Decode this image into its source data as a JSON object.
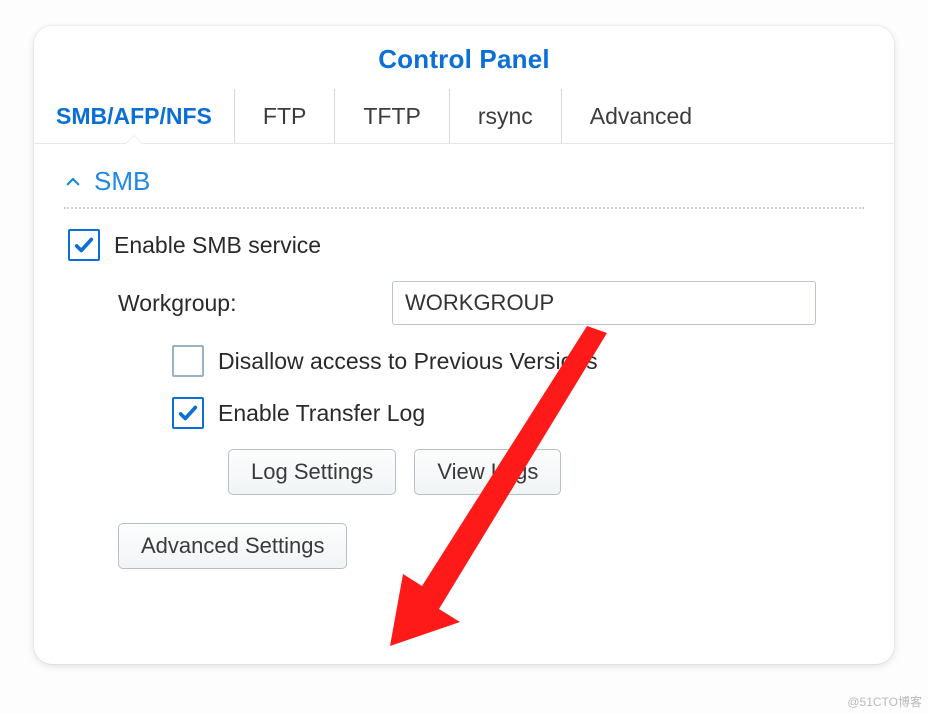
{
  "title": "Control Panel",
  "tabs": [
    {
      "label": "SMB/AFP/NFS",
      "active": true
    },
    {
      "label": "FTP"
    },
    {
      "label": "TFTP"
    },
    {
      "label": "rsync"
    },
    {
      "label": "Advanced"
    }
  ],
  "section": {
    "header_label": "SMB",
    "collapsed": false
  },
  "smb": {
    "enable_service": {
      "label": "Enable SMB service",
      "checked": true
    },
    "workgroup": {
      "label": "Workgroup:",
      "value": "WORKGROUP"
    },
    "disallow_prev": {
      "label": "Disallow access to Previous Versions",
      "checked": false
    },
    "enable_transfer_log": {
      "label": "Enable Transfer Log",
      "checked": true
    },
    "buttons": {
      "log_settings": "Log Settings",
      "view_logs": "View Logs",
      "advanced_settings": "Advanced Settings"
    }
  },
  "annotation": {
    "arrow_color": "#ff1a1a"
  },
  "watermark": "@51CTO博客"
}
